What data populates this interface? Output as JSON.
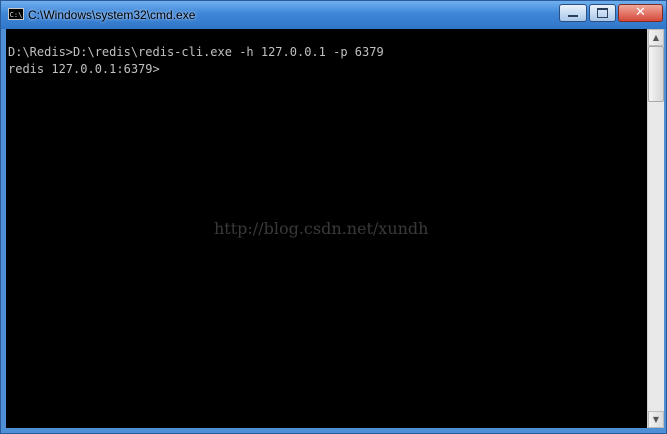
{
  "window": {
    "title": "C:\\Windows\\system32\\cmd.exe",
    "icon_text": "C:\\",
    "controls": {
      "minimize": "minimize-icon",
      "maximize": "maximize-icon",
      "close": "close-icon",
      "close_glyph": "✕"
    }
  },
  "console": {
    "lines": [
      "D:\\Redis>D:\\redis\\redis-cli.exe -h 127.0.0.1 -p 6379",
      "redis 127.0.0.1:6379>"
    ],
    "watermark": "http://blog.csdn.net/xundh"
  },
  "scrollbar": {
    "up_glyph": "▲",
    "down_glyph": "▼"
  },
  "colors": {
    "console_bg": "#000000",
    "console_text": "#c0c0c0",
    "titlebar": "#3f86d8",
    "close_button": "#d5483a"
  }
}
